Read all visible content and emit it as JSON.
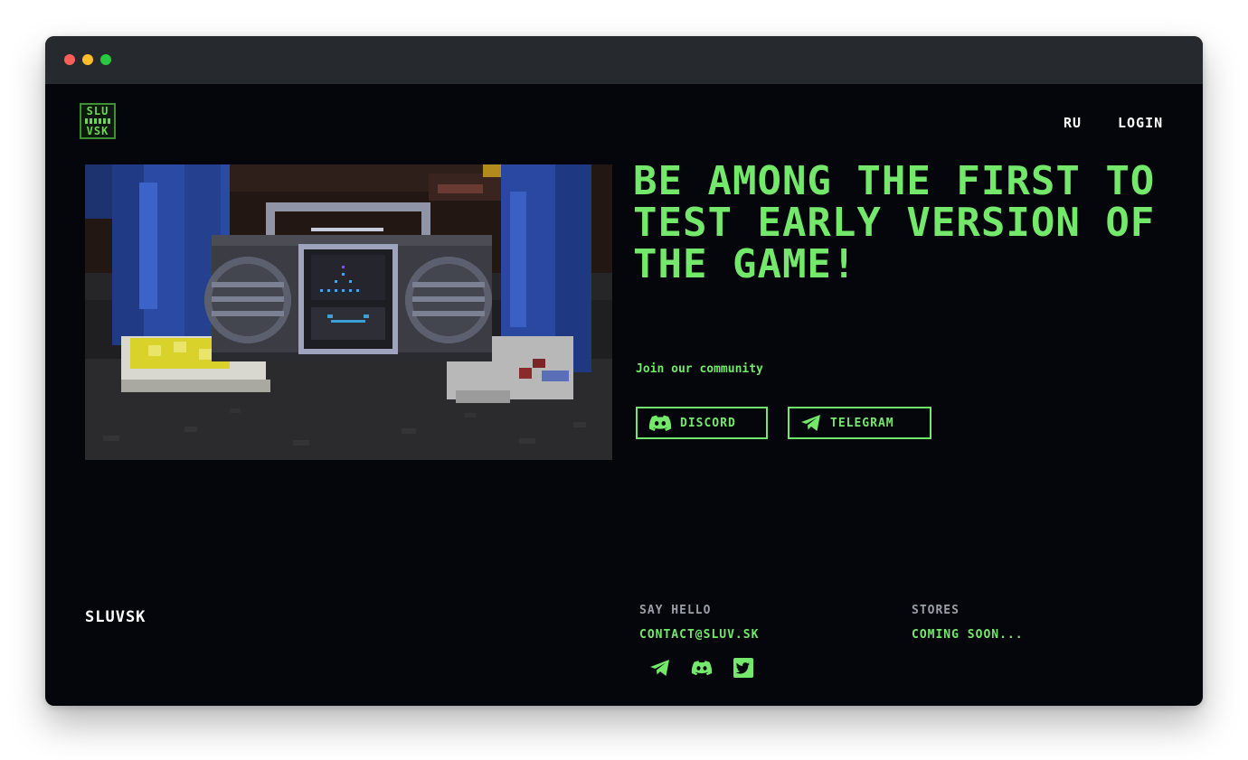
{
  "colors": {
    "accent": "#74e86a",
    "background": "#04060b",
    "muted": "#9b9fa6"
  },
  "logo": {
    "line1": "SLU",
    "line2": "VSK"
  },
  "nav": {
    "lang_label": "RU",
    "login_label": "LOGIN"
  },
  "hero": {
    "headline": "BE AMONG THE FIRST TO TEST EARLY VERSION OF THE GAME!",
    "community_label": "Join our community",
    "buttons": [
      {
        "label": "DISCORD",
        "icon": "discord-icon"
      },
      {
        "label": "TELEGRAM",
        "icon": "telegram-icon"
      }
    ]
  },
  "footer": {
    "brand": "SLUVSK",
    "say_hello": {
      "heading": "SAY HELLO",
      "value": "CONTACT@SLUV.SK"
    },
    "stores": {
      "heading": "STORES",
      "value": "COMING SOON..."
    },
    "icons": [
      "telegram-icon",
      "discord-icon",
      "twitter-icon"
    ]
  }
}
